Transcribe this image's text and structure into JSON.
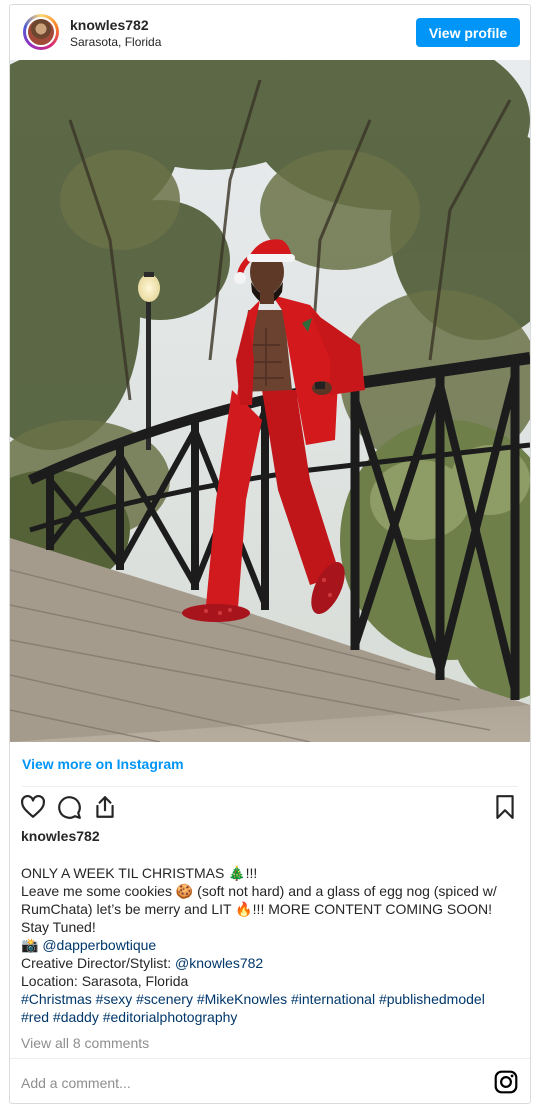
{
  "header": {
    "username": "knowles782",
    "location": "Sarasota, Florida",
    "view_profile_label": "View profile"
  },
  "photo": {
    "subject": "man in red suit and santa hat leaning on bridge railing",
    "colors": {
      "suit": "#d41a1e",
      "sky": "#e7ebee",
      "wood": "#a49a8c",
      "railing": "#1c1c1c"
    }
  },
  "view_more_label": "View more on Instagram",
  "actions": {
    "like_icon": "heart-icon",
    "comment_icon": "comment-icon",
    "share_icon": "share-icon",
    "save_icon": "bookmark-icon"
  },
  "post": {
    "username": "knowles782",
    "caption": {
      "line1": "ONLY A WEEK TIL CHRISTMAS 🎄!!!",
      "line2": "Leave me some cookies 🍪 (soft not hard) and a glass of egg nog (spiced w/",
      "line3": "RumChata) let’s be merry and LIT 🔥!!! MORE CONTENT COMING SOON!",
      "line4": "Stay Tuned!",
      "line5_icon": "📸",
      "line5_link": "@dapperbowtique",
      "line6_text": "Creative Director/Stylist: ",
      "line6_link": "@knowles782",
      "line7": "Location: Sarasota, Florida",
      "hashtags_line1": "#Christmas #sexy #scenery #MikeKnowles #international #publishedmodel",
      "hashtags_line2": "#red #daddy #editorialphotography"
    },
    "view_comments": "View all 8 comments"
  },
  "comment_box": {
    "placeholder": "Add a comment..."
  },
  "brand": {
    "accent": "#0095f6",
    "link": "#00376b"
  }
}
